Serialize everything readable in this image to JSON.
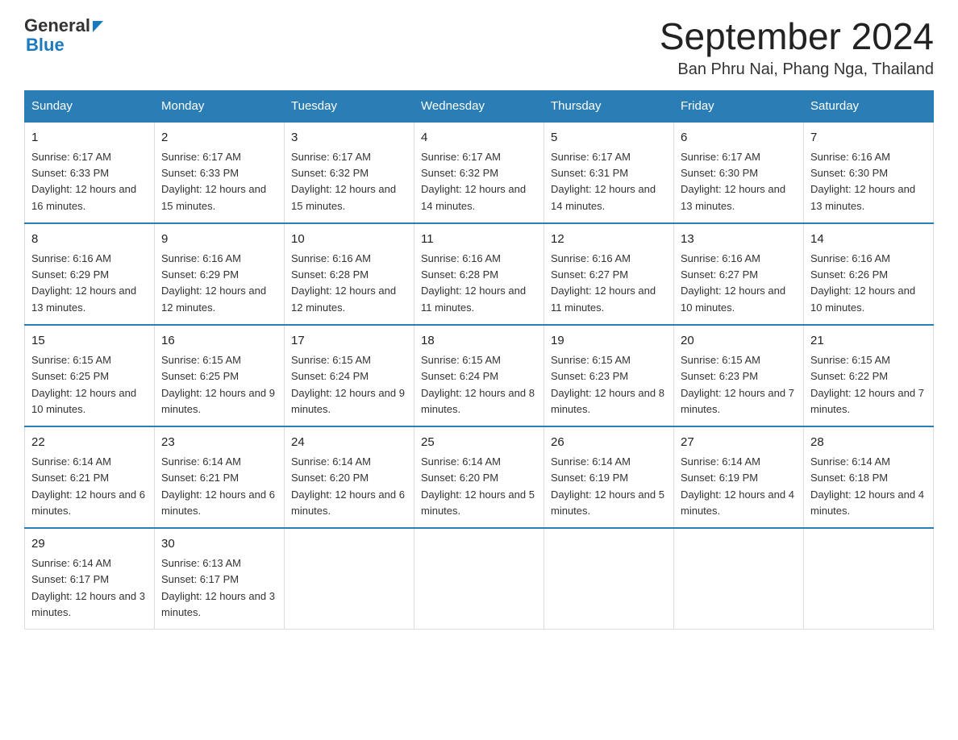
{
  "logo": {
    "general": "General",
    "blue": "Blue"
  },
  "header": {
    "month_year": "September 2024",
    "location": "Ban Phru Nai, Phang Nga, Thailand"
  },
  "days_of_week": [
    "Sunday",
    "Monday",
    "Tuesday",
    "Wednesday",
    "Thursday",
    "Friday",
    "Saturday"
  ],
  "weeks": [
    [
      {
        "day": "1",
        "sunrise": "6:17 AM",
        "sunset": "6:33 PM",
        "daylight": "12 hours and 16 minutes."
      },
      {
        "day": "2",
        "sunrise": "6:17 AM",
        "sunset": "6:33 PM",
        "daylight": "12 hours and 15 minutes."
      },
      {
        "day": "3",
        "sunrise": "6:17 AM",
        "sunset": "6:32 PM",
        "daylight": "12 hours and 15 minutes."
      },
      {
        "day": "4",
        "sunrise": "6:17 AM",
        "sunset": "6:32 PM",
        "daylight": "12 hours and 14 minutes."
      },
      {
        "day": "5",
        "sunrise": "6:17 AM",
        "sunset": "6:31 PM",
        "daylight": "12 hours and 14 minutes."
      },
      {
        "day": "6",
        "sunrise": "6:17 AM",
        "sunset": "6:30 PM",
        "daylight": "12 hours and 13 minutes."
      },
      {
        "day": "7",
        "sunrise": "6:16 AM",
        "sunset": "6:30 PM",
        "daylight": "12 hours and 13 minutes."
      }
    ],
    [
      {
        "day": "8",
        "sunrise": "6:16 AM",
        "sunset": "6:29 PM",
        "daylight": "12 hours and 13 minutes."
      },
      {
        "day": "9",
        "sunrise": "6:16 AM",
        "sunset": "6:29 PM",
        "daylight": "12 hours and 12 minutes."
      },
      {
        "day": "10",
        "sunrise": "6:16 AM",
        "sunset": "6:28 PM",
        "daylight": "12 hours and 12 minutes."
      },
      {
        "day": "11",
        "sunrise": "6:16 AM",
        "sunset": "6:28 PM",
        "daylight": "12 hours and 11 minutes."
      },
      {
        "day": "12",
        "sunrise": "6:16 AM",
        "sunset": "6:27 PM",
        "daylight": "12 hours and 11 minutes."
      },
      {
        "day": "13",
        "sunrise": "6:16 AM",
        "sunset": "6:27 PM",
        "daylight": "12 hours and 10 minutes."
      },
      {
        "day": "14",
        "sunrise": "6:16 AM",
        "sunset": "6:26 PM",
        "daylight": "12 hours and 10 minutes."
      }
    ],
    [
      {
        "day": "15",
        "sunrise": "6:15 AM",
        "sunset": "6:25 PM",
        "daylight": "12 hours and 10 minutes."
      },
      {
        "day": "16",
        "sunrise": "6:15 AM",
        "sunset": "6:25 PM",
        "daylight": "12 hours and 9 minutes."
      },
      {
        "day": "17",
        "sunrise": "6:15 AM",
        "sunset": "6:24 PM",
        "daylight": "12 hours and 9 minutes."
      },
      {
        "day": "18",
        "sunrise": "6:15 AM",
        "sunset": "6:24 PM",
        "daylight": "12 hours and 8 minutes."
      },
      {
        "day": "19",
        "sunrise": "6:15 AM",
        "sunset": "6:23 PM",
        "daylight": "12 hours and 8 minutes."
      },
      {
        "day": "20",
        "sunrise": "6:15 AM",
        "sunset": "6:23 PM",
        "daylight": "12 hours and 7 minutes."
      },
      {
        "day": "21",
        "sunrise": "6:15 AM",
        "sunset": "6:22 PM",
        "daylight": "12 hours and 7 minutes."
      }
    ],
    [
      {
        "day": "22",
        "sunrise": "6:14 AM",
        "sunset": "6:21 PM",
        "daylight": "12 hours and 6 minutes."
      },
      {
        "day": "23",
        "sunrise": "6:14 AM",
        "sunset": "6:21 PM",
        "daylight": "12 hours and 6 minutes."
      },
      {
        "day": "24",
        "sunrise": "6:14 AM",
        "sunset": "6:20 PM",
        "daylight": "12 hours and 6 minutes."
      },
      {
        "day": "25",
        "sunrise": "6:14 AM",
        "sunset": "6:20 PM",
        "daylight": "12 hours and 5 minutes."
      },
      {
        "day": "26",
        "sunrise": "6:14 AM",
        "sunset": "6:19 PM",
        "daylight": "12 hours and 5 minutes."
      },
      {
        "day": "27",
        "sunrise": "6:14 AM",
        "sunset": "6:19 PM",
        "daylight": "12 hours and 4 minutes."
      },
      {
        "day": "28",
        "sunrise": "6:14 AM",
        "sunset": "6:18 PM",
        "daylight": "12 hours and 4 minutes."
      }
    ],
    [
      {
        "day": "29",
        "sunrise": "6:14 AM",
        "sunset": "6:17 PM",
        "daylight": "12 hours and 3 minutes."
      },
      {
        "day": "30",
        "sunrise": "6:13 AM",
        "sunset": "6:17 PM",
        "daylight": "12 hours and 3 minutes."
      },
      null,
      null,
      null,
      null,
      null
    ]
  ]
}
